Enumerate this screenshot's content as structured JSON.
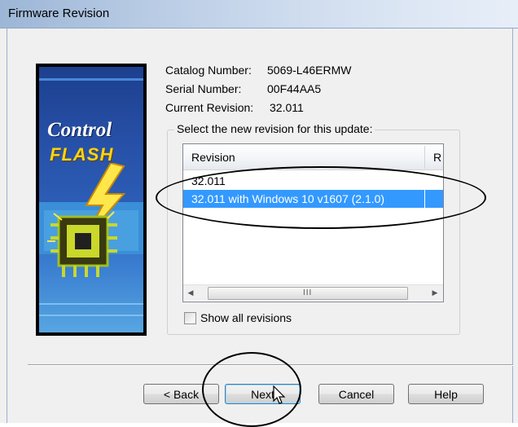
{
  "window": {
    "title": "Firmware Revision"
  },
  "logo": {
    "line1": "Control",
    "line2": "FLASH"
  },
  "info": {
    "catalog_label": "Catalog Number:",
    "catalog_value": "5069-L46ERMW",
    "serial_label": "Serial Number:",
    "serial_value": "00F44AA5",
    "revision_label": "Current Revision:",
    "revision_value": "32.011"
  },
  "group": {
    "label": "Select the new revision for this update:",
    "columns": [
      "Revision",
      "R"
    ],
    "rows": [
      {
        "revision": "32.011",
        "selected": false
      },
      {
        "revision": "32.011 with Windows 10 v1607 (2.1.0)",
        "selected": true
      }
    ],
    "scroll_grip": "III",
    "show_all_label": "Show all revisions",
    "show_all_checked": false
  },
  "buttons": {
    "back": "< Back",
    "next": "Next",
    "cancel": "Cancel",
    "help": "Help"
  },
  "colors": {
    "selection": "#3399ff",
    "title_bar": "#b8cbe4",
    "dialog_bg": "#f0f0f0"
  }
}
